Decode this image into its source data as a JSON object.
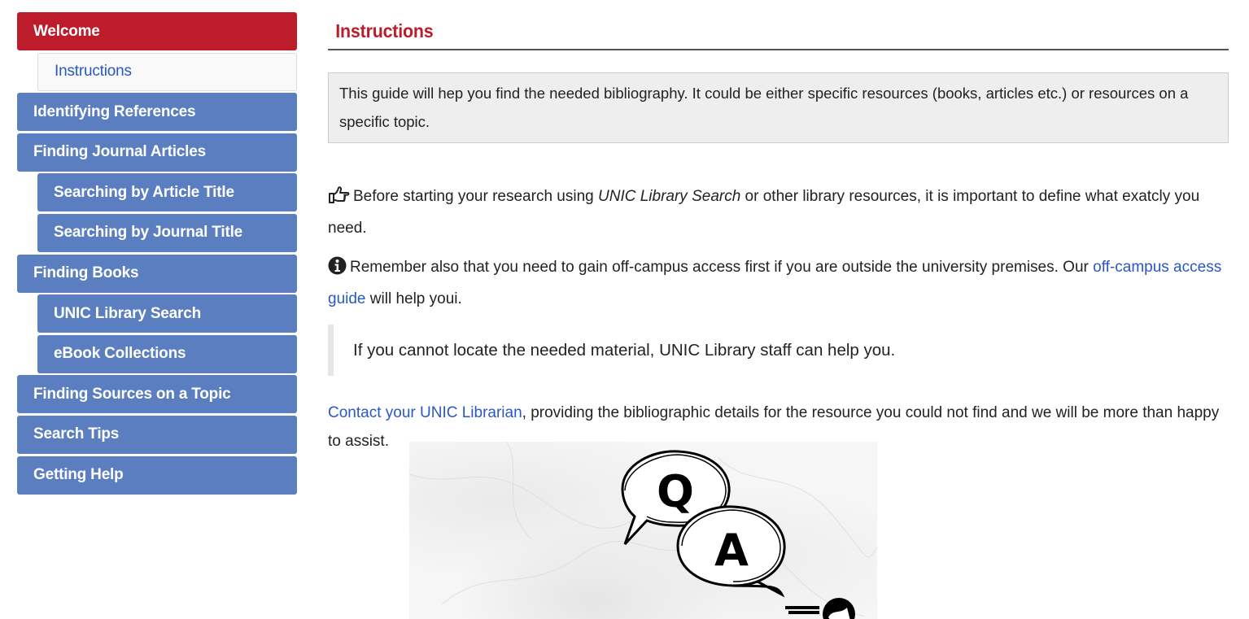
{
  "sidebar": {
    "items": [
      {
        "label": "Welcome"
      },
      {
        "label": "Instructions"
      },
      {
        "label": "Identifying References"
      },
      {
        "label": "Finding Journal Articles"
      },
      {
        "label": "Searching by Article Title"
      },
      {
        "label": "Searching by Journal Title"
      },
      {
        "label": "Finding Books"
      },
      {
        "label": "UNIC Library Search"
      },
      {
        "label": "eBook Collections"
      },
      {
        "label": "Finding Sources on a Topic"
      },
      {
        "label": "Search Tips"
      },
      {
        "label": "Getting Help"
      }
    ]
  },
  "main": {
    "title": "Instructions",
    "intro": "This guide will hep you find the needed bibliography. It could be either specific resources (books, articles etc.) or resources on a specific topic.",
    "p1": {
      "before": "Before starting your research using ",
      "em": "UNIC Library Search",
      "after": " or other library resources, it is important to define what exatcly you need."
    },
    "p2": {
      "before": "Remember also that you need to gain off-campus access first if you are outside the university premises. Our ",
      "link": "off-campus access guide",
      "after": " will help youi."
    },
    "quote": "If you cannot locate the needed material, UNIC Library staff can help you.",
    "p3": {
      "link": "Contact your UNIC Librarian",
      "after": ", providing the bibliographic details for the resource you could not find and we will be more than happy to assist."
    },
    "image": {
      "letter_q": "Q",
      "letter_a": "A"
    }
  },
  "colors": {
    "accent_red": "#bd1c2b",
    "nav_blue": "#5a7ec0",
    "link_blue": "#2a57c3"
  },
  "icons": [
    "hand-point-right-icon",
    "info-circle-icon"
  ]
}
